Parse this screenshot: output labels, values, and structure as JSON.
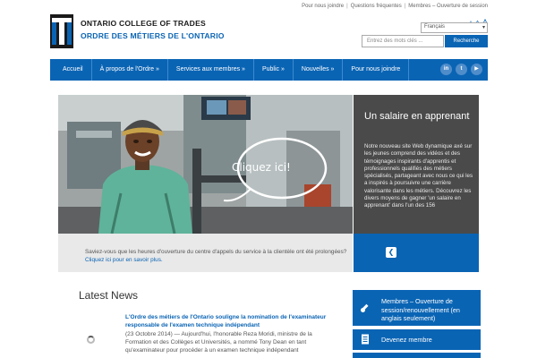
{
  "brand": {
    "name_en": "ONTARIO COLLEGE OF TRADES",
    "name_fr": "ORDRE DES MÉTIERS DE L'ONTARIO"
  },
  "utility_links": [
    "Pour nous joindre",
    "Questions fréquentes",
    "Membres – Ouverture de session"
  ],
  "font_size_controls": [
    "A",
    "A",
    "A"
  ],
  "language_select": {
    "selected": "Français"
  },
  "search": {
    "placeholder": "Entrez des mots clés ...",
    "button_label": "Recherche"
  },
  "nav": {
    "items": [
      "Accueil",
      "À propos de l'Ordre »",
      "Services aux membres »",
      "Public »",
      "Nouvelles »",
      "Pour nous joindre"
    ],
    "social_icons": [
      "linkedin-icon",
      "twitter-icon",
      "youtube-icon"
    ]
  },
  "hero": {
    "callout": "Cliquez ici!",
    "panel_title": "Un salaire en apprenant",
    "panel_text": "Notre nouveau site Web dynamique axé sur les jeunes comprend des vidéos et des témoignages inspirants d'apprentis et professionnels qualifiés des métiers spécialisés, partageant avec nous ce qui les a inspirés à poursuivre une carrière valorisante dans les métiers. Découvrez les divers moyens de gagner 'un salaire en apprenant' dans l'un des 156"
  },
  "info_bar": {
    "text": "Saviez-vous que les heures d'ouverture du centre d'appels du service à la clientèle ont été prolongées?",
    "link": "Cliquez ici pour en savoir plus."
  },
  "news": {
    "heading": "Latest News",
    "item_title": "L'Ordre des métiers de l'Ontario souligne la nomination de l'examinateur responsable de l'examen technique indépendant",
    "item_body": "(23 Octobre 2014) — Aujourd'hui, l'honorable Reza Moridi, ministre de la Formation et des Collèges et Universités, a nommé Tony Dean en tant qu'examinateur pour procéder à un examen technique indépendant"
  },
  "quick_links": [
    "Membres – Ouverture de session/renouvellement (en anglais seulement)",
    "Devenez membre"
  ],
  "colors": {
    "brand_blue": "#0a64b4",
    "panel_gray": "#4a4a4a",
    "info_gray": "#e9e9e9"
  }
}
